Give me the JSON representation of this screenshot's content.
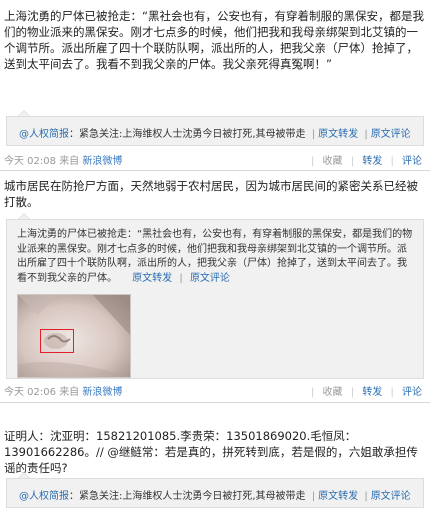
{
  "post1": {
    "text": "上海沈勇的尸体已被抢走：“黑社会也有，公安也有，有穿着制服的黑保安，都是我们的物业派来的黑保安。刚才七点多的时候，他们把我和我母亲绑架到北艾镇的一个调节所。派出所雇了四十个联防队啊，派出所的人，把我父亲（尸体）抢掉了，送到太平间去了。我看不到我父亲的尸体。我父亲死得真冤啊！”",
    "quote": {
      "user": "@人权简报",
      "text": "：紧急关注:上海维权人士沈勇今日被打死,其母被带走",
      "repost": "原文转发",
      "comment": "原文评论"
    },
    "footer": {
      "time": "今天 02:08",
      "from": "来自",
      "source": "新浪微博"
    },
    "actions": {
      "fav": "收藏",
      "repost": "转发",
      "comment": "评论"
    }
  },
  "post2": {
    "text": "城市居民在防抢尸方面，天然地弱于农村居民，因为城市居民间的紧密关系已经被打散。",
    "quote": {
      "user": "@人权简报",
      "text": "上海沈勇的尸体已被抢走：“黑社会也有，公安也有，有穿着制服的黑保安，都是我们的物业派来的黑保安。刚才七点多的时候，他们把我和我母亲绑架到北艾镇的一个调节所。派出所雇了四十个联防队啊，派出所的人，把我父亲（尸体）抢掉了，送到太平间去了。我看不到我父亲的尸体。",
      "repost": "原文转发",
      "comment": "原文评论"
    },
    "footer": {
      "time": "今天 02:06",
      "from": "来自",
      "source": "新浪微博"
    },
    "actions": {
      "fav": "收藏",
      "repost": "转发",
      "comment": "评论"
    }
  },
  "post3": {
    "text": "证明人：沈亚明：15821201085.李贵荣：13501869020.毛恒凤：13901662286。// @继鲢常：若是真的，拼死转到底，若是假的，六姐敢承担传谣的责任吗?",
    "quote": {
      "user": "@人权简报",
      "text": "：紧急关注:上海维权人士沈勇今日被打死,其母被带走",
      "repost": "原文转发",
      "comment": "原文评论"
    }
  }
}
